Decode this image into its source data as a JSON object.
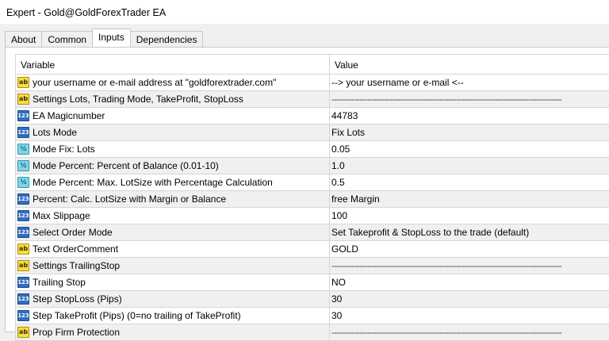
{
  "window": {
    "title": "Expert - Gold@GoldForexTrader EA"
  },
  "tabs": [
    {
      "label": "About",
      "active": false
    },
    {
      "label": "Common",
      "active": false
    },
    {
      "label": "Inputs",
      "active": true
    },
    {
      "label": "Dependencies",
      "active": false
    }
  ],
  "grid": {
    "headers": {
      "variable": "Variable",
      "value": "Value"
    },
    "rows": [
      {
        "icon": "ab",
        "variable": "your username or e-mail address at \"goldforextrader.com\"",
        "value": "--> your username or e-mail <--",
        "group": false
      },
      {
        "icon": "ab",
        "variable": "Settings Lots, Trading Mode, TakeProfit, StopLoss",
        "value": "-----------------------------------------------------------------------------------",
        "group": true
      },
      {
        "icon": "num",
        "variable": "EA Magicnumber",
        "value": "44783",
        "group": false
      },
      {
        "icon": "num",
        "variable": "Lots Mode",
        "value": "Fix Lots",
        "group": true
      },
      {
        "icon": "frac",
        "variable": "Mode Fix: Lots",
        "value": "0.05",
        "group": false
      },
      {
        "icon": "frac",
        "variable": "Mode Percent: Percent of Balance (0.01-10)",
        "value": "1.0",
        "group": true
      },
      {
        "icon": "frac",
        "variable": "Mode Percent: Max. LotSize with Percentage Calculation",
        "value": "0.5",
        "group": false
      },
      {
        "icon": "num",
        "variable": "Percent: Calc. LotSize with Margin or Balance",
        "value": "free Margin",
        "group": true
      },
      {
        "icon": "num",
        "variable": "Max Slippage",
        "value": "100",
        "group": false
      },
      {
        "icon": "num",
        "variable": "Select Order Mode",
        "value": "Set Takeprofit & StopLoss to the trade (default)",
        "group": true
      },
      {
        "icon": "ab",
        "variable": "Text OrderComment",
        "value": "GOLD",
        "group": false
      },
      {
        "icon": "ab",
        "variable": "Settings TrailingStop",
        "value": "-----------------------------------------------------------------------------------",
        "group": true
      },
      {
        "icon": "num",
        "variable": "Trailing Stop",
        "value": "NO",
        "group": false
      },
      {
        "icon": "num",
        "variable": "Step StopLoss (Pips)",
        "value": "30",
        "group": true
      },
      {
        "icon": "num",
        "variable": "Step TakeProfit (Pips) (0=no trailing of TakeProfit)",
        "value": "30",
        "group": false
      },
      {
        "icon": "ab",
        "variable": "Prop Firm Protection",
        "value": "-----------------------------------------------------------------------------------",
        "group": true
      }
    ]
  },
  "icons": {
    "ab": {
      "glyph": "ab",
      "name": "string-type-icon"
    },
    "num": {
      "glyph": "123",
      "name": "integer-type-icon"
    },
    "frac": {
      "glyph": "½",
      "name": "double-type-icon"
    }
  }
}
